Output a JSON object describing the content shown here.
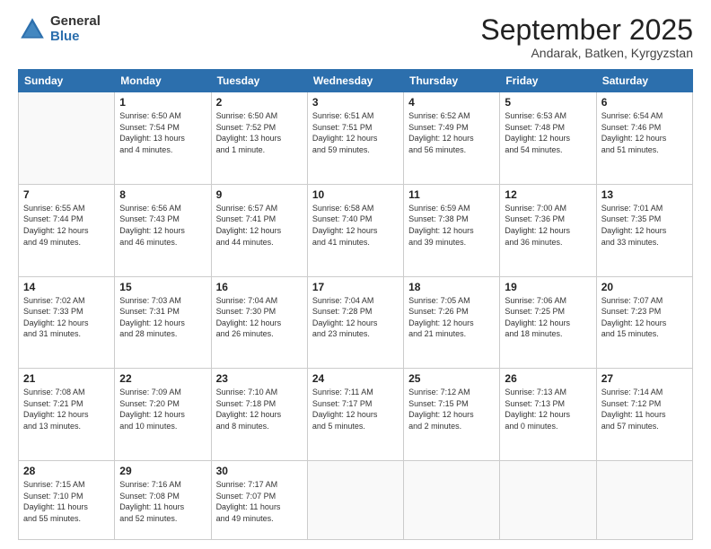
{
  "logo": {
    "general": "General",
    "blue": "Blue"
  },
  "header": {
    "month": "September 2025",
    "location": "Andarak, Batken, Kyrgyzstan"
  },
  "weekdays": [
    "Sunday",
    "Monday",
    "Tuesday",
    "Wednesday",
    "Thursday",
    "Friday",
    "Saturday"
  ],
  "weeks": [
    [
      {
        "day": "",
        "info": ""
      },
      {
        "day": "1",
        "info": "Sunrise: 6:50 AM\nSunset: 7:54 PM\nDaylight: 13 hours\nand 4 minutes."
      },
      {
        "day": "2",
        "info": "Sunrise: 6:50 AM\nSunset: 7:52 PM\nDaylight: 13 hours\nand 1 minute."
      },
      {
        "day": "3",
        "info": "Sunrise: 6:51 AM\nSunset: 7:51 PM\nDaylight: 12 hours\nand 59 minutes."
      },
      {
        "day": "4",
        "info": "Sunrise: 6:52 AM\nSunset: 7:49 PM\nDaylight: 12 hours\nand 56 minutes."
      },
      {
        "day": "5",
        "info": "Sunrise: 6:53 AM\nSunset: 7:48 PM\nDaylight: 12 hours\nand 54 minutes."
      },
      {
        "day": "6",
        "info": "Sunrise: 6:54 AM\nSunset: 7:46 PM\nDaylight: 12 hours\nand 51 minutes."
      }
    ],
    [
      {
        "day": "7",
        "info": "Sunrise: 6:55 AM\nSunset: 7:44 PM\nDaylight: 12 hours\nand 49 minutes."
      },
      {
        "day": "8",
        "info": "Sunrise: 6:56 AM\nSunset: 7:43 PM\nDaylight: 12 hours\nand 46 minutes."
      },
      {
        "day": "9",
        "info": "Sunrise: 6:57 AM\nSunset: 7:41 PM\nDaylight: 12 hours\nand 44 minutes."
      },
      {
        "day": "10",
        "info": "Sunrise: 6:58 AM\nSunset: 7:40 PM\nDaylight: 12 hours\nand 41 minutes."
      },
      {
        "day": "11",
        "info": "Sunrise: 6:59 AM\nSunset: 7:38 PM\nDaylight: 12 hours\nand 39 minutes."
      },
      {
        "day": "12",
        "info": "Sunrise: 7:00 AM\nSunset: 7:36 PM\nDaylight: 12 hours\nand 36 minutes."
      },
      {
        "day": "13",
        "info": "Sunrise: 7:01 AM\nSunset: 7:35 PM\nDaylight: 12 hours\nand 33 minutes."
      }
    ],
    [
      {
        "day": "14",
        "info": "Sunrise: 7:02 AM\nSunset: 7:33 PM\nDaylight: 12 hours\nand 31 minutes."
      },
      {
        "day": "15",
        "info": "Sunrise: 7:03 AM\nSunset: 7:31 PM\nDaylight: 12 hours\nand 28 minutes."
      },
      {
        "day": "16",
        "info": "Sunrise: 7:04 AM\nSunset: 7:30 PM\nDaylight: 12 hours\nand 26 minutes."
      },
      {
        "day": "17",
        "info": "Sunrise: 7:04 AM\nSunset: 7:28 PM\nDaylight: 12 hours\nand 23 minutes."
      },
      {
        "day": "18",
        "info": "Sunrise: 7:05 AM\nSunset: 7:26 PM\nDaylight: 12 hours\nand 21 minutes."
      },
      {
        "day": "19",
        "info": "Sunrise: 7:06 AM\nSunset: 7:25 PM\nDaylight: 12 hours\nand 18 minutes."
      },
      {
        "day": "20",
        "info": "Sunrise: 7:07 AM\nSunset: 7:23 PM\nDaylight: 12 hours\nand 15 minutes."
      }
    ],
    [
      {
        "day": "21",
        "info": "Sunrise: 7:08 AM\nSunset: 7:21 PM\nDaylight: 12 hours\nand 13 minutes."
      },
      {
        "day": "22",
        "info": "Sunrise: 7:09 AM\nSunset: 7:20 PM\nDaylight: 12 hours\nand 10 minutes."
      },
      {
        "day": "23",
        "info": "Sunrise: 7:10 AM\nSunset: 7:18 PM\nDaylight: 12 hours\nand 8 minutes."
      },
      {
        "day": "24",
        "info": "Sunrise: 7:11 AM\nSunset: 7:17 PM\nDaylight: 12 hours\nand 5 minutes."
      },
      {
        "day": "25",
        "info": "Sunrise: 7:12 AM\nSunset: 7:15 PM\nDaylight: 12 hours\nand 2 minutes."
      },
      {
        "day": "26",
        "info": "Sunrise: 7:13 AM\nSunset: 7:13 PM\nDaylight: 12 hours\nand 0 minutes."
      },
      {
        "day": "27",
        "info": "Sunrise: 7:14 AM\nSunset: 7:12 PM\nDaylight: 11 hours\nand 57 minutes."
      }
    ],
    [
      {
        "day": "28",
        "info": "Sunrise: 7:15 AM\nSunset: 7:10 PM\nDaylight: 11 hours\nand 55 minutes."
      },
      {
        "day": "29",
        "info": "Sunrise: 7:16 AM\nSunset: 7:08 PM\nDaylight: 11 hours\nand 52 minutes."
      },
      {
        "day": "30",
        "info": "Sunrise: 7:17 AM\nSunset: 7:07 PM\nDaylight: 11 hours\nand 49 minutes."
      },
      {
        "day": "",
        "info": ""
      },
      {
        "day": "",
        "info": ""
      },
      {
        "day": "",
        "info": ""
      },
      {
        "day": "",
        "info": ""
      }
    ]
  ]
}
